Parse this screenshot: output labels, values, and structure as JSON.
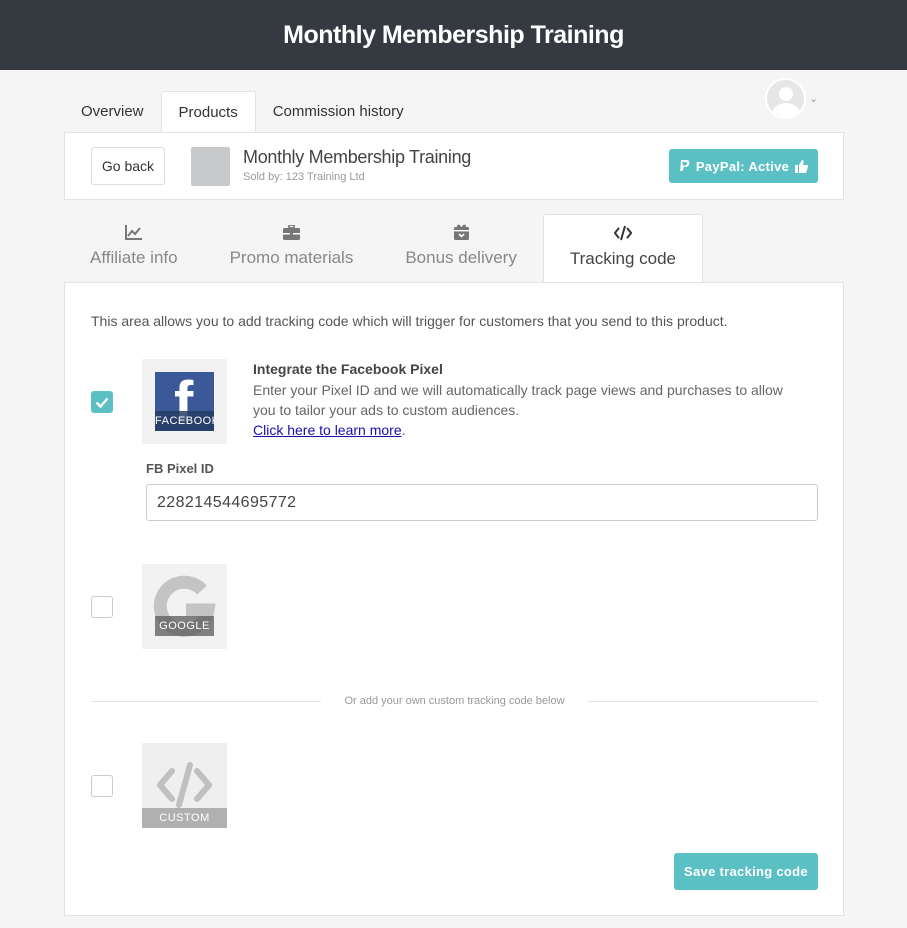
{
  "header": {
    "title": "Monthly Membership Training"
  },
  "main_tabs": [
    {
      "label": "Overview",
      "active": false
    },
    {
      "label": "Products",
      "active": true
    },
    {
      "label": "Commission history",
      "active": false
    }
  ],
  "product": {
    "back_label": "Go back",
    "title": "Monthly Membership Training",
    "sold_by": "Sold by: 123 Training Ltd",
    "paypal_label": "PayPal: Active"
  },
  "sub_tabs": [
    {
      "label": "Affiliate info",
      "icon": "chart-icon",
      "active": false
    },
    {
      "label": "Promo materials",
      "icon": "briefcase-icon",
      "active": false
    },
    {
      "label": "Bonus delivery",
      "icon": "gift-icon",
      "active": false
    },
    {
      "label": "Tracking code",
      "icon": "code-icon",
      "active": true
    }
  ],
  "tracking": {
    "intro": "This area allows you to add tracking code which will trigger for customers that you send to this product.",
    "facebook": {
      "checked": true,
      "tile_label": "FACEBOOK",
      "title": "Integrate the Facebook Pixel",
      "description": "Enter your Pixel ID and we will automatically track page views and purchases to allow you to tailor your ads to custom audiences.",
      "link_text": "Click here to learn more",
      "link_suffix": ".",
      "field_label": "FB Pixel ID",
      "field_value": "228214544695772"
    },
    "google": {
      "checked": false,
      "tile_label": "GOOGLE"
    },
    "divider_text": "Or add your own custom tracking code below",
    "custom": {
      "checked": false,
      "tile_label": "CUSTOM"
    },
    "save_label": "Save tracking code"
  },
  "colors": {
    "topbar": "#343a40",
    "accent": "#5bc0c4",
    "facebook": "#3b5998"
  }
}
